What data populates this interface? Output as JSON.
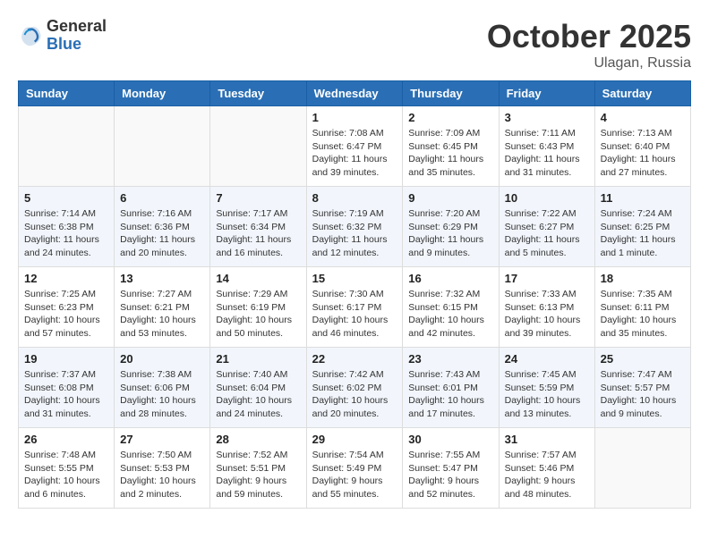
{
  "header": {
    "logo_general": "General",
    "logo_blue": "Blue",
    "month": "October 2025",
    "location": "Ulagan, Russia"
  },
  "weekdays": [
    "Sunday",
    "Monday",
    "Tuesday",
    "Wednesday",
    "Thursday",
    "Friday",
    "Saturday"
  ],
  "weeks": [
    [
      {
        "day": "",
        "info": ""
      },
      {
        "day": "",
        "info": ""
      },
      {
        "day": "",
        "info": ""
      },
      {
        "day": "1",
        "info": "Sunrise: 7:08 AM\nSunset: 6:47 PM\nDaylight: 11 hours\nand 39 minutes."
      },
      {
        "day": "2",
        "info": "Sunrise: 7:09 AM\nSunset: 6:45 PM\nDaylight: 11 hours\nand 35 minutes."
      },
      {
        "day": "3",
        "info": "Sunrise: 7:11 AM\nSunset: 6:43 PM\nDaylight: 11 hours\nand 31 minutes."
      },
      {
        "day": "4",
        "info": "Sunrise: 7:13 AM\nSunset: 6:40 PM\nDaylight: 11 hours\nand 27 minutes."
      }
    ],
    [
      {
        "day": "5",
        "info": "Sunrise: 7:14 AM\nSunset: 6:38 PM\nDaylight: 11 hours\nand 24 minutes."
      },
      {
        "day": "6",
        "info": "Sunrise: 7:16 AM\nSunset: 6:36 PM\nDaylight: 11 hours\nand 20 minutes."
      },
      {
        "day": "7",
        "info": "Sunrise: 7:17 AM\nSunset: 6:34 PM\nDaylight: 11 hours\nand 16 minutes."
      },
      {
        "day": "8",
        "info": "Sunrise: 7:19 AM\nSunset: 6:32 PM\nDaylight: 11 hours\nand 12 minutes."
      },
      {
        "day": "9",
        "info": "Sunrise: 7:20 AM\nSunset: 6:29 PM\nDaylight: 11 hours\nand 9 minutes."
      },
      {
        "day": "10",
        "info": "Sunrise: 7:22 AM\nSunset: 6:27 PM\nDaylight: 11 hours\nand 5 minutes."
      },
      {
        "day": "11",
        "info": "Sunrise: 7:24 AM\nSunset: 6:25 PM\nDaylight: 11 hours\nand 1 minute."
      }
    ],
    [
      {
        "day": "12",
        "info": "Sunrise: 7:25 AM\nSunset: 6:23 PM\nDaylight: 10 hours\nand 57 minutes."
      },
      {
        "day": "13",
        "info": "Sunrise: 7:27 AM\nSunset: 6:21 PM\nDaylight: 10 hours\nand 53 minutes."
      },
      {
        "day": "14",
        "info": "Sunrise: 7:29 AM\nSunset: 6:19 PM\nDaylight: 10 hours\nand 50 minutes."
      },
      {
        "day": "15",
        "info": "Sunrise: 7:30 AM\nSunset: 6:17 PM\nDaylight: 10 hours\nand 46 minutes."
      },
      {
        "day": "16",
        "info": "Sunrise: 7:32 AM\nSunset: 6:15 PM\nDaylight: 10 hours\nand 42 minutes."
      },
      {
        "day": "17",
        "info": "Sunrise: 7:33 AM\nSunset: 6:13 PM\nDaylight: 10 hours\nand 39 minutes."
      },
      {
        "day": "18",
        "info": "Sunrise: 7:35 AM\nSunset: 6:11 PM\nDaylight: 10 hours\nand 35 minutes."
      }
    ],
    [
      {
        "day": "19",
        "info": "Sunrise: 7:37 AM\nSunset: 6:08 PM\nDaylight: 10 hours\nand 31 minutes."
      },
      {
        "day": "20",
        "info": "Sunrise: 7:38 AM\nSunset: 6:06 PM\nDaylight: 10 hours\nand 28 minutes."
      },
      {
        "day": "21",
        "info": "Sunrise: 7:40 AM\nSunset: 6:04 PM\nDaylight: 10 hours\nand 24 minutes."
      },
      {
        "day": "22",
        "info": "Sunrise: 7:42 AM\nSunset: 6:02 PM\nDaylight: 10 hours\nand 20 minutes."
      },
      {
        "day": "23",
        "info": "Sunrise: 7:43 AM\nSunset: 6:01 PM\nDaylight: 10 hours\nand 17 minutes."
      },
      {
        "day": "24",
        "info": "Sunrise: 7:45 AM\nSunset: 5:59 PM\nDaylight: 10 hours\nand 13 minutes."
      },
      {
        "day": "25",
        "info": "Sunrise: 7:47 AM\nSunset: 5:57 PM\nDaylight: 10 hours\nand 9 minutes."
      }
    ],
    [
      {
        "day": "26",
        "info": "Sunrise: 7:48 AM\nSunset: 5:55 PM\nDaylight: 10 hours\nand 6 minutes."
      },
      {
        "day": "27",
        "info": "Sunrise: 7:50 AM\nSunset: 5:53 PM\nDaylight: 10 hours\nand 2 minutes."
      },
      {
        "day": "28",
        "info": "Sunrise: 7:52 AM\nSunset: 5:51 PM\nDaylight: 9 hours\nand 59 minutes."
      },
      {
        "day": "29",
        "info": "Sunrise: 7:54 AM\nSunset: 5:49 PM\nDaylight: 9 hours\nand 55 minutes."
      },
      {
        "day": "30",
        "info": "Sunrise: 7:55 AM\nSunset: 5:47 PM\nDaylight: 9 hours\nand 52 minutes."
      },
      {
        "day": "31",
        "info": "Sunrise: 7:57 AM\nSunset: 5:46 PM\nDaylight: 9 hours\nand 48 minutes."
      },
      {
        "day": "",
        "info": ""
      }
    ]
  ]
}
